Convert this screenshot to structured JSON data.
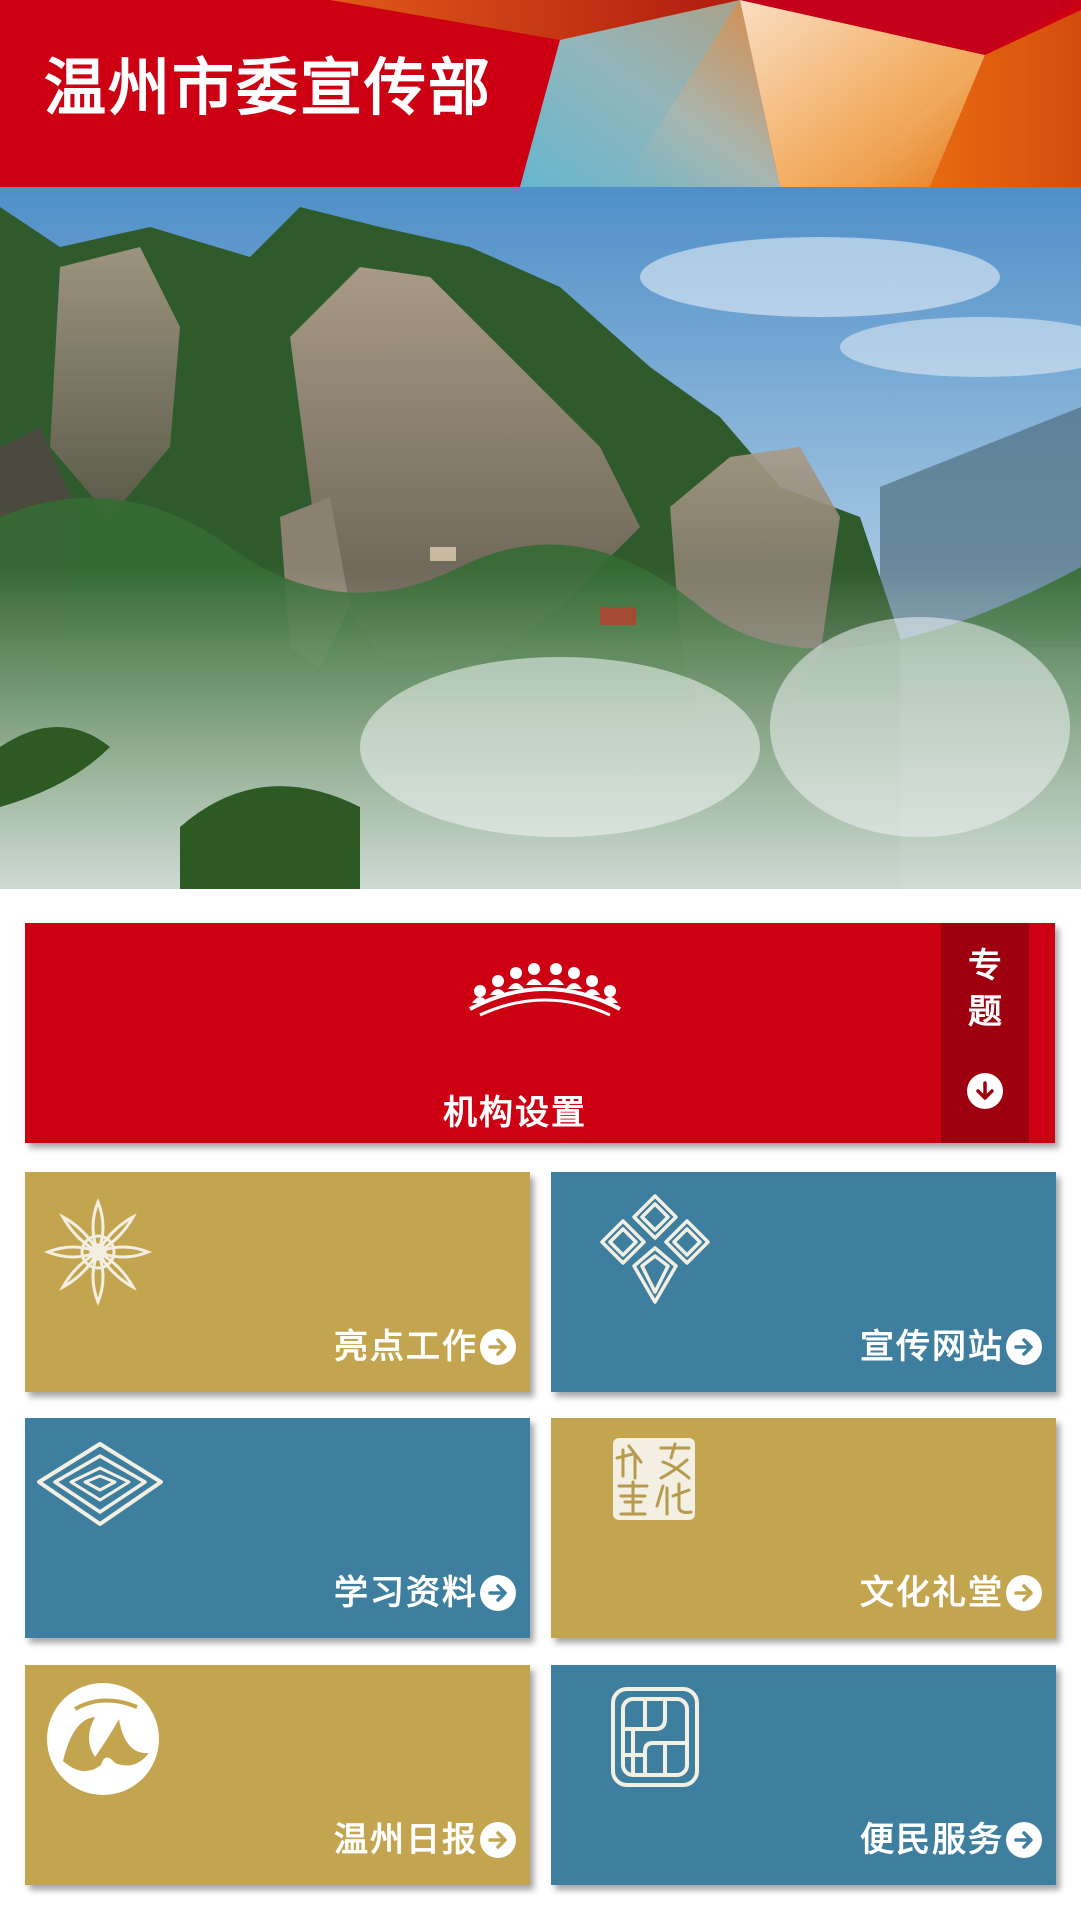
{
  "header": {
    "title": "温州市委宣传部"
  },
  "hero": {
    "alt": "mountain-landscape"
  },
  "feature": {
    "label": "机构设置",
    "special_label": "专\n题"
  },
  "tiles": [
    {
      "label": "亮点工作",
      "color": "#c4a54f",
      "icon": "chrysanthemum-icon"
    },
    {
      "label": "宣传网站",
      "color": "#3e7e9e",
      "icon": "diamond-knot-icon"
    },
    {
      "label": "学习资料",
      "color": "#3e7e9e",
      "icon": "layered-diamond-icon"
    },
    {
      "label": "文化礼堂",
      "color": "#c4a54f",
      "icon": "culture-hall-seal-icon",
      "seal_text": "文化礼堂"
    },
    {
      "label": "温州日报",
      "color": "#c4a54f",
      "icon": "wenzhou-daily-logo-icon"
    },
    {
      "label": "便民服务",
      "color": "#3e7e9e",
      "icon": "service-window-icon"
    }
  ],
  "colors": {
    "brand_red": "#cc0012",
    "dark_red": "#9e0010",
    "gold": "#c4a54f",
    "blue": "#3e7e9e"
  }
}
